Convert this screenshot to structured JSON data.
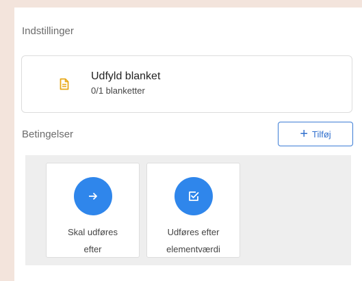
{
  "settings": {
    "title": "Indstillinger",
    "form": {
      "name": "Udfyld blanket",
      "progress": "0/1 blanketter",
      "icon": "document-icon",
      "icon_color": "#e8a817"
    }
  },
  "conditions": {
    "title": "Betingelser",
    "add_label": "Tilføj",
    "add_icon": "plus-icon",
    "accent": "#2f86eb",
    "cards": [
      {
        "label_line1": "Skal udføres",
        "label_line2": "efter",
        "icon": "arrow-right-icon"
      },
      {
        "label_line1": "Udføres efter",
        "label_line2": "elementværdi",
        "icon": "checkbox-edit-icon"
      }
    ]
  }
}
